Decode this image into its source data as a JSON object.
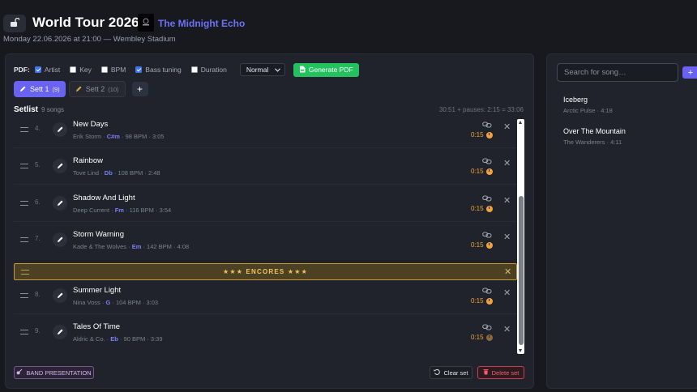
{
  "header": {
    "title": "World Tour 2026",
    "band_name": "The Midnight Echo",
    "subtitle": "Monday 22.06.2026 at 21:00 — Wembley Stadium"
  },
  "pdf": {
    "label": "PDF:",
    "options": [
      {
        "label": "Artist",
        "checked": true
      },
      {
        "label": "Key",
        "checked": false
      },
      {
        "label": "BPM",
        "checked": false
      },
      {
        "label": "Bass tuning",
        "checked": true
      },
      {
        "label": "Duration",
        "checked": false
      }
    ],
    "format_selected": "Normal",
    "generate_label": "Generate PDF"
  },
  "tabs": [
    {
      "label": "Sett 1",
      "count": "(9)",
      "active": true
    },
    {
      "label": "Sett 2",
      "count": "(10)",
      "active": false
    }
  ],
  "setlist": {
    "title": "Setlist",
    "count": "9 songs",
    "durations": "30:51 + pauses: 2:15 = 33:06",
    "rows": [
      {
        "num": "4.",
        "title": "New Days",
        "artist": "Erik Storm",
        "key": "C#m",
        "bpm": "98 BPM",
        "length": "3:05",
        "pause": "0:15"
      },
      {
        "num": "5.",
        "title": "Rainbow",
        "artist": "Tove Lind",
        "key": "Db",
        "bpm": "108 BPM",
        "length": "2:48",
        "pause": "0:15"
      },
      {
        "num": "6.",
        "title": "Shadow And Light",
        "artist": "Deep Current",
        "key": "Fm",
        "bpm": "116 BPM",
        "length": "3:54",
        "pause": "0:15"
      },
      {
        "num": "7.",
        "title": "Storm Warning",
        "artist": "Kade & The Wolves",
        "key": "Em",
        "bpm": "142 BPM",
        "length": "4:08",
        "pause": "0:15"
      }
    ],
    "encore_label": "★★★   ENCORES   ★★★",
    "rows_after": [
      {
        "num": "8.",
        "title": "Summer Light",
        "artist": "Nina Voss",
        "key": "G",
        "bpm": "104 BPM",
        "length": "3:03",
        "pause": "0:15"
      },
      {
        "num": "9.",
        "title": "Tales Of Time",
        "artist": "Aldric & Co.",
        "key": "Eb",
        "bpm": "90 BPM",
        "length": "3:39",
        "pause": "0:15"
      }
    ]
  },
  "footer": {
    "band_presentation": "BAND PRESENTATION",
    "clear_set": "Clear set",
    "delete_set": "Delete set"
  },
  "sidebar": {
    "search_placeholder": "Search for song…",
    "songs": [
      {
        "title": "Iceberg",
        "sub": "Arctic Pulse · 4:18"
      },
      {
        "title": "Over The Mountain",
        "sub": "The Wanderers · 4:11"
      }
    ]
  },
  "colors": {
    "accent": "#6a62f2",
    "generate_green": "#22c35e",
    "pause_orange": "#f2a23a",
    "encore_gold": "#f1c45c",
    "delete_red": "#ff5a69"
  }
}
